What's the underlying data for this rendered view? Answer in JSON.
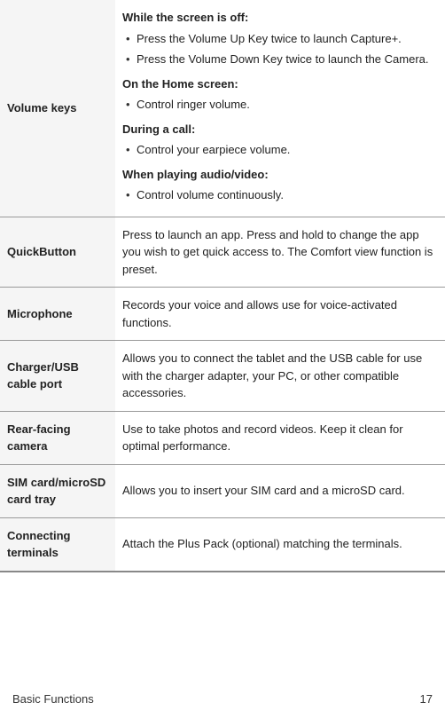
{
  "rows": [
    {
      "label": "Volume keys",
      "sections": [
        {
          "header": "While the screen is off:",
          "bullets": [
            "Press the Volume Up Key twice to launch Capture+.",
            "Press the Volume Down Key twice to launch the Camera."
          ]
        },
        {
          "header": "On the Home screen:",
          "bullets": [
            "Control ringer volume."
          ]
        },
        {
          "header": "During a call:",
          "bullets": [
            "Control your earpiece volume."
          ]
        },
        {
          "header": "When playing audio/video:",
          "bullets": [
            "Control volume continuously."
          ]
        }
      ]
    },
    {
      "label": "QuickButton",
      "text": "Press to launch an app. Press and hold to change the app you wish to get quick access to. The Comfort view function is preset."
    },
    {
      "label": "Microphone",
      "text": "Records your voice and allows use for voice-activated functions."
    },
    {
      "label": "Charger/USB cable port",
      "text": "Allows you to connect the tablet and the USB cable for use with the charger adapter, your PC, or other compatible accessories."
    },
    {
      "label": "Rear-facing camera",
      "text": "Use to take photos and record videos. Keep it clean for optimal performance."
    },
    {
      "label": "SIM card/microSD card tray",
      "text": "Allows you to insert your SIM card and a microSD card."
    },
    {
      "label": "Connecting terminals",
      "text": "Attach the Plus Pack (optional) matching the terminals."
    }
  ],
  "footer": {
    "section": "Basic Functions",
    "page": "17"
  }
}
